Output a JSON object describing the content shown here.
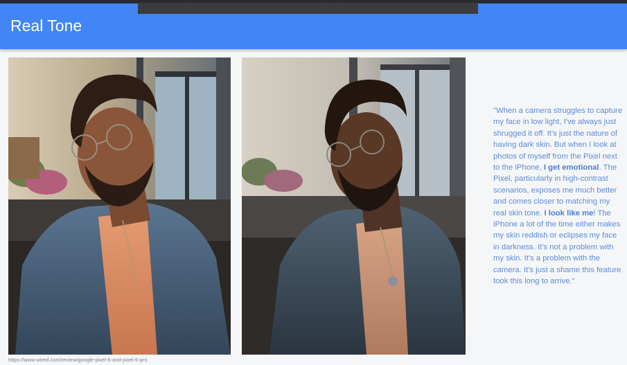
{
  "app_bar": {
    "title": "Real Tone",
    "color": "#4285f4"
  },
  "photos": [
    {
      "icon": "portrait-photo-icon",
      "label": ""
    },
    {
      "icon": "portrait-photo-icon",
      "label": ""
    }
  ],
  "quote": {
    "part1": "\"When a camera struggles to capture my face in low light, I've always just shrugged it off. It's just the nature of having dark skin. But when I look at photos of myself from the Pixel next to the iPhone, ",
    "bold1": "I get emotional",
    "part2": ". The Pixel, particularly in high-contrast scenarios, exposes me much better and comes closer to matching my real skin tone. ",
    "bold2": "I look like me",
    "part3": "! The iPhone a lot of the time either makes my skin reddish or eclipses my face in darkness. It's not a problem with my skin. It's a problem with the camera. It's just a shame this feature took this long to arrive.\"",
    "color": "#5b8bd9"
  },
  "footer": {
    "source_url": "https://www.wired.com/review/google-pixel-6-and-pixel-6-pro"
  }
}
